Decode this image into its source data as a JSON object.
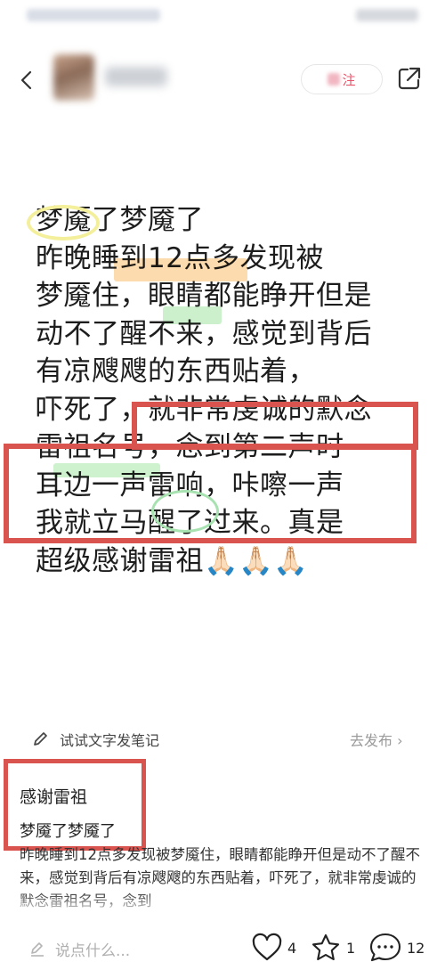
{
  "header": {
    "follow_label": "注"
  },
  "post": {
    "lines": [
      "梦魇了梦魇了",
      "昨晚睡到12点多发现被",
      "梦魇住，眼睛都能睁开但是",
      "动不了醒不来，感觉到背后",
      "有凉飕飕的东西贴着，",
      "吓死了，就非常虔诚的默念",
      "雷祖名号，念到第二声时",
      "耳边一声雷响，咔嚓一声",
      "我就立马醒了过来。真是",
      "超级感谢雷祖🙏🏻🙏🏻🙏🏻"
    ]
  },
  "suggest": {
    "label": "试试文字发笔记",
    "publish": "去发布 ›"
  },
  "note": {
    "title": "感谢雷祖",
    "subtitle": "梦魇了梦魇了",
    "body": "昨晚睡到12点多发现被梦魇住，眼睛都能睁开但是动不了醒不来，感觉到背后有凉飕飕的东西贴着，吓死了，就非常虔诚的默念雷祖名号，念到"
  },
  "bottom": {
    "comment_placeholder": "说点什么...",
    "likes": "4",
    "favorites": "1",
    "comments": "12"
  },
  "colors": {
    "annotation_red": "#d9534f",
    "highlight_orange": "#fabe6e",
    "highlight_green": "#b9ebb9",
    "highlight_yellow": "#f3ef9a"
  },
  "icons": [
    "back-icon",
    "share-icon",
    "pen-icon",
    "chevron-right-icon",
    "edit-icon",
    "heart-icon",
    "star-icon",
    "comment-icon"
  ]
}
